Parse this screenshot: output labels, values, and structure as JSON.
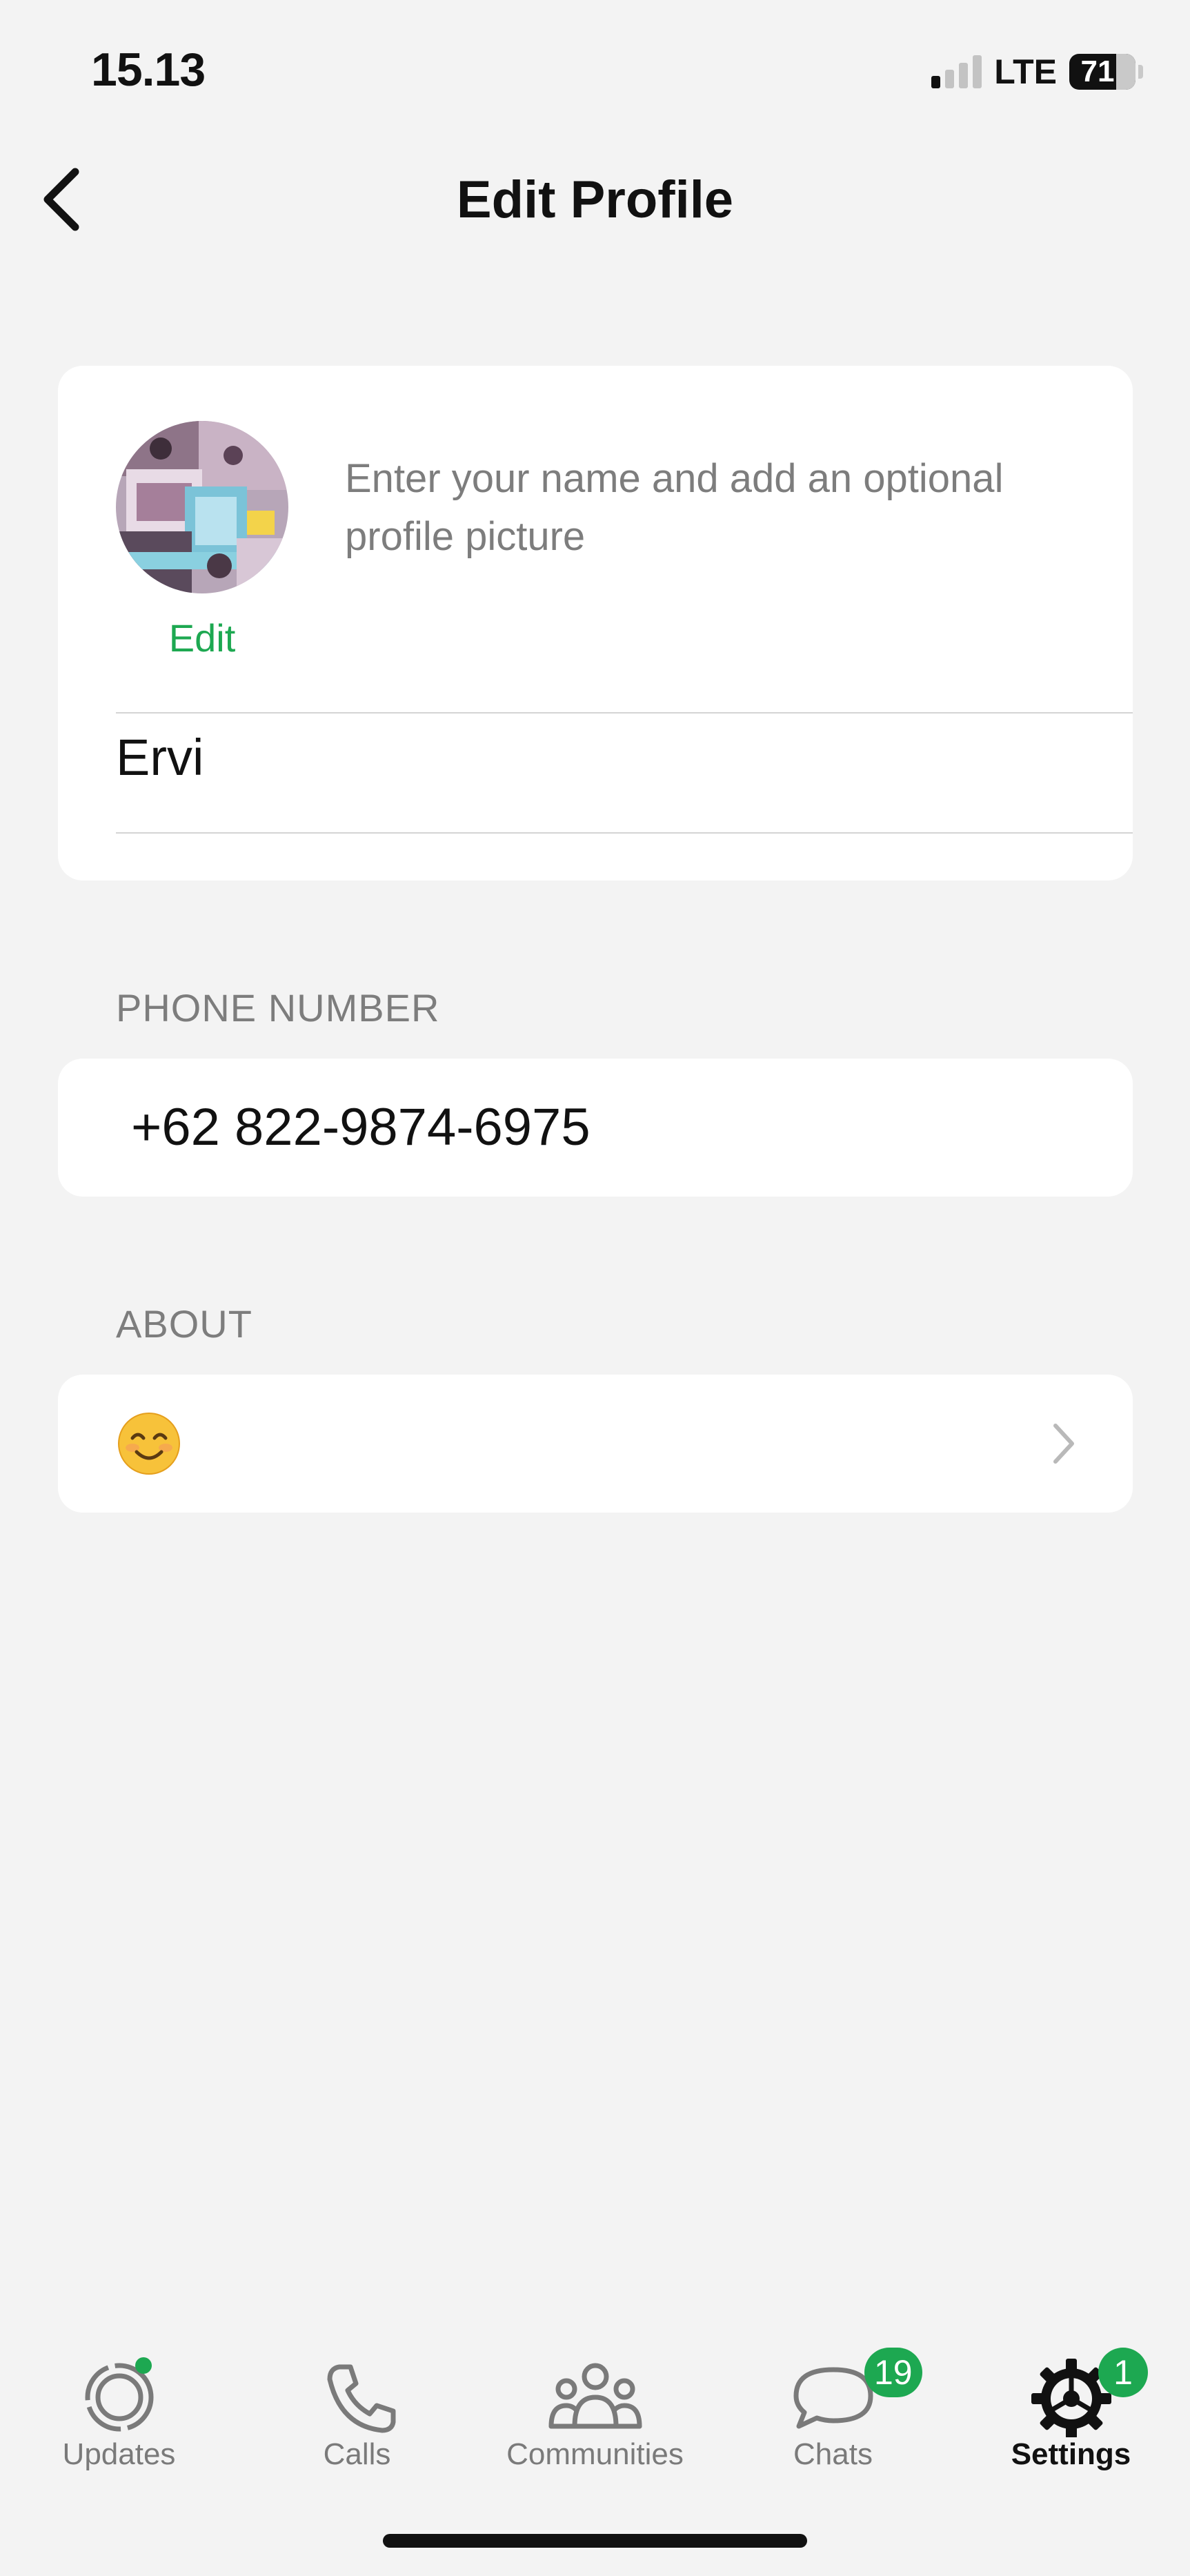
{
  "status_bar": {
    "time": "15.13",
    "network": "LTE",
    "battery_level": "71"
  },
  "header": {
    "title": "Edit Profile"
  },
  "profile": {
    "avatar_edit_label": "Edit",
    "hint": "Enter your name and add an optional profile picture",
    "name": "Ervi"
  },
  "phone": {
    "section_label": "PHONE NUMBER",
    "value": "+62 822-9874-6975"
  },
  "about": {
    "section_label": "ABOUT",
    "value_icon": "smiling-face-emoji"
  },
  "tab_bar": {
    "tabs": [
      {
        "label": "Updates",
        "icon": "updates-icon",
        "has_dot": true
      },
      {
        "label": "Calls",
        "icon": "phone-icon"
      },
      {
        "label": "Communities",
        "icon": "communities-icon"
      },
      {
        "label": "Chats",
        "icon": "chat-icon",
        "badge": "19"
      },
      {
        "label": "Settings",
        "icon": "gear-icon",
        "badge": "1",
        "active": true
      }
    ]
  },
  "colors": {
    "accent": "#1da851",
    "background": "#f3f3f3",
    "secondary_text": "#7d7d7d"
  }
}
